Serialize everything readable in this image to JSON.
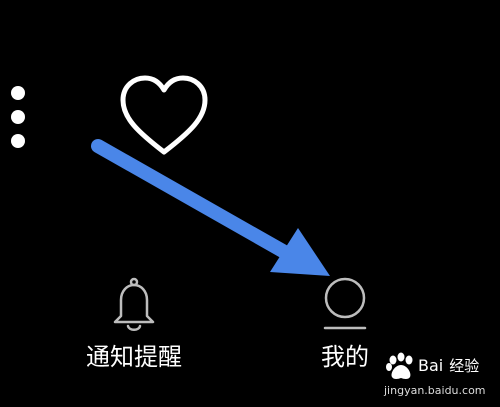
{
  "nav": {
    "notify_label": "通知提醒",
    "mine_label": "我的"
  },
  "watermark": {
    "brand_bai": "Bai",
    "brand_jingyan": "经验",
    "url": "jingyan.baidu.com"
  },
  "colors": {
    "background": "#000000",
    "foreground": "#ffffff",
    "icon_stroke": "#bdbdbd",
    "arrow": "#4a86e8"
  },
  "icons": {
    "menu": "vertical-dots-icon",
    "heart": "heart-outline-icon",
    "notify": "bell-icon",
    "mine": "user-circle-icon"
  }
}
